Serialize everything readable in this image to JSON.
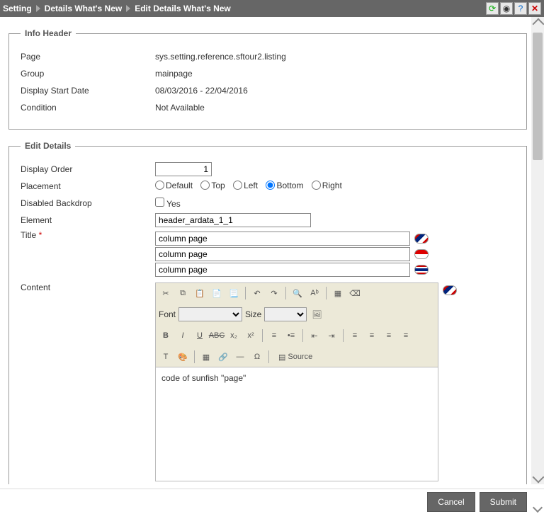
{
  "breadcrumb": [
    "Setting",
    "Details What's New",
    "Edit Details What's New"
  ],
  "info_header": {
    "legend": "Info Header",
    "page_label": "Page",
    "page_value": "sys.setting.reference.sftour2.listing",
    "group_label": "Group",
    "group_value": "mainpage",
    "date_label": "Display Start Date",
    "date_value": "08/03/2016   -   22/04/2016",
    "condition_label": "Condition",
    "condition_value": "Not Available"
  },
  "edit_details": {
    "legend": "Edit Details",
    "display_order_label": "Display Order",
    "display_order_value": "1",
    "placement_label": "Placement",
    "placement_options": [
      "Default",
      "Top",
      "Left",
      "Bottom",
      "Right"
    ],
    "placement_selected": "Bottom",
    "backdrop_label": "Disabled Backdrop",
    "backdrop_option": "Yes",
    "backdrop_checked": false,
    "element_label": "Element",
    "element_value": "header_ardata_1_1",
    "title_label": "Title",
    "title_values": [
      "column page",
      "column page",
      "column page"
    ],
    "content_label": "Content",
    "font_label": "Font",
    "size_label": "Size",
    "source_label": "Source",
    "content_body": "code of sunfish \"page\""
  },
  "footer": {
    "cancel": "Cancel",
    "submit": "Submit"
  }
}
